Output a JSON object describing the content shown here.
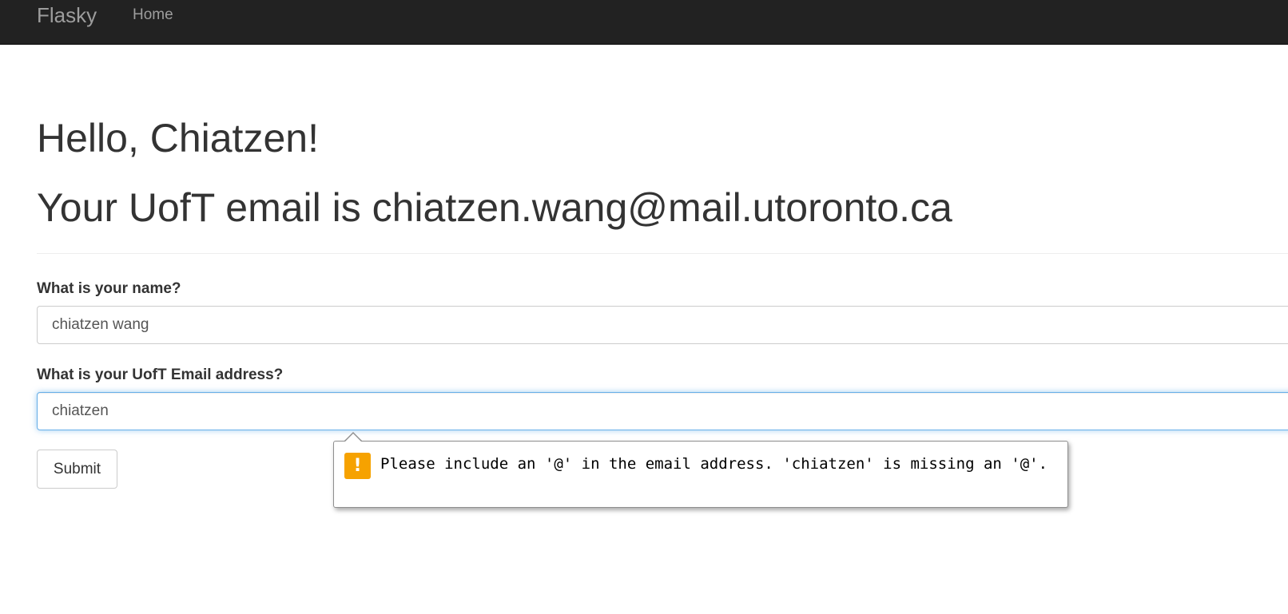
{
  "navbar": {
    "brand": "Flasky",
    "items": [
      {
        "label": "Home"
      }
    ]
  },
  "header": {
    "greeting": "Hello, Chiatzen!",
    "email_line": "Your UofT email is chiatzen.wang@mail.utoronto.ca"
  },
  "form": {
    "name_label": "What is your name?",
    "name_value": "chiatzen wang",
    "email_label": "What is your UofT Email address?",
    "email_value": "chiatzen",
    "submit_label": "Submit"
  },
  "validation_tooltip": {
    "icon": "warning-icon",
    "icon_glyph": "!",
    "icon_color": "#f6a200",
    "message": "Please include an '@' in the email address. 'chiatzen' is missing an '@'."
  },
  "colors": {
    "navbar_bg": "#222222",
    "nav_text": "#9d9d9d",
    "focus_border": "#66afe9",
    "warning": "#f6a200"
  }
}
